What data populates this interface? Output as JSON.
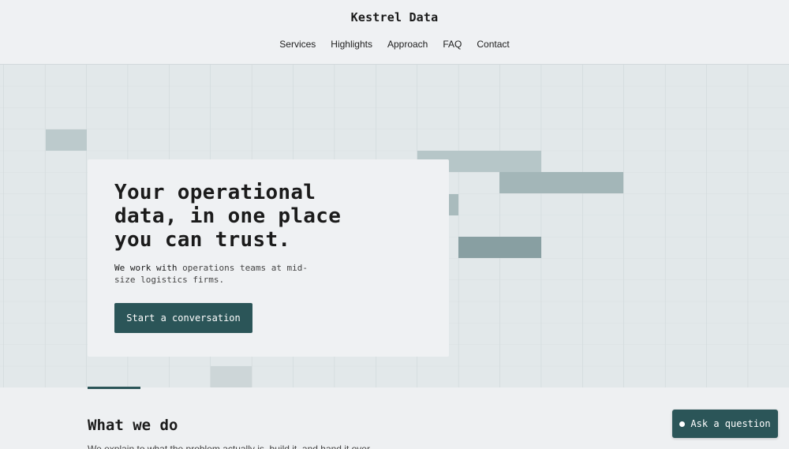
{
  "header": {
    "brand": "Kestrel Data",
    "nav": [
      "Services",
      "Highlights",
      "Approach",
      "FAQ",
      "Contact"
    ]
  },
  "hero": {
    "title": "Your operational data, in one place you can trust.",
    "subtitle_lead": "We work with",
    "subtitle_rest": " operations teams at mid-size logistics firms.",
    "cta_label": "Start a conversation"
  },
  "section": {
    "title": "What we do",
    "text": "We explain to what the problem actually is, build it, and hand it over."
  },
  "chat": {
    "label": "Ask a question"
  },
  "colors": {
    "accent": "#2b5558",
    "hero_bg": "#e2e8ea"
  }
}
